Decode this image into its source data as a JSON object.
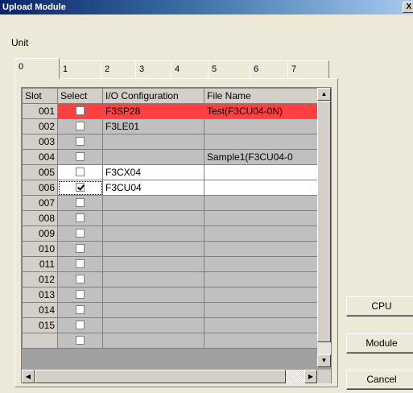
{
  "window": {
    "title": "Upload Module",
    "close_glyph": "X"
  },
  "unit_label": "Unit",
  "tabs": [
    "0",
    "1",
    "2",
    "3",
    "4",
    "5",
    "6",
    "7"
  ],
  "active_tab": "0",
  "table": {
    "headers": {
      "slot": "Slot",
      "select": "Select",
      "io": "I/O Configuration",
      "file": "File Name"
    },
    "rows": [
      {
        "slot": "001",
        "checked": false,
        "io": "F3SP28",
        "file": "Test(F3CU04-0N)",
        "style": "red"
      },
      {
        "slot": "002",
        "checked": false,
        "io": "F3LE01",
        "file": "",
        "style": "gray"
      },
      {
        "slot": "003",
        "checked": false,
        "io": "",
        "file": "",
        "style": "gray"
      },
      {
        "slot": "004",
        "checked": false,
        "io": "",
        "file": "Sample1(F3CU04-0",
        "style": "gray"
      },
      {
        "slot": "005",
        "checked": false,
        "io": "F3CX04",
        "file": "",
        "style": "white"
      },
      {
        "slot": "006",
        "checked": true,
        "io": "F3CU04",
        "file": "",
        "style": "white",
        "focus": true
      },
      {
        "slot": "007",
        "checked": false,
        "io": "",
        "file": "",
        "style": "gray"
      },
      {
        "slot": "008",
        "checked": false,
        "io": "",
        "file": "",
        "style": "gray"
      },
      {
        "slot": "009",
        "checked": false,
        "io": "",
        "file": "",
        "style": "gray"
      },
      {
        "slot": "010",
        "checked": false,
        "io": "",
        "file": "",
        "style": "gray"
      },
      {
        "slot": "011",
        "checked": false,
        "io": "",
        "file": "",
        "style": "gray"
      },
      {
        "slot": "012",
        "checked": false,
        "io": "",
        "file": "",
        "style": "gray"
      },
      {
        "slot": "013",
        "checked": false,
        "io": "",
        "file": "",
        "style": "gray"
      },
      {
        "slot": "014",
        "checked": false,
        "io": "",
        "file": "",
        "style": "gray"
      },
      {
        "slot": "015",
        "checked": false,
        "io": "",
        "file": "",
        "style": "gray"
      },
      {
        "slot": "",
        "checked": false,
        "io": "",
        "file": "",
        "style": "gray"
      }
    ]
  },
  "buttons": {
    "cpu": "CPU",
    "module": "Module",
    "cancel": "Cancel"
  },
  "colors": {
    "highlight_row": "#ff4040",
    "inactive_cell": "#c0c0c0",
    "title_gradient_start": "#0a246a"
  }
}
